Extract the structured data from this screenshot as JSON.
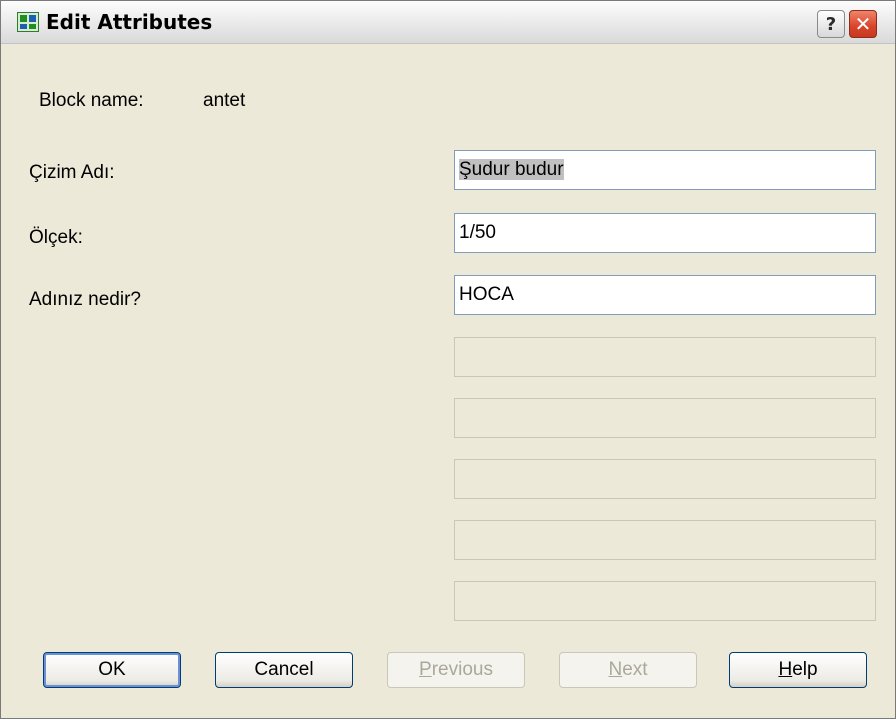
{
  "window": {
    "title": "Edit Attributes"
  },
  "block": {
    "label": "Block name:",
    "value": "antet"
  },
  "attributes": [
    {
      "label": "Çizim Adı:",
      "value": "Şudur budur"
    },
    {
      "label": "Ölçek:",
      "value": "1/50"
    },
    {
      "label": "Adınız nedir?",
      "value": "HOCA"
    }
  ],
  "buttons": {
    "ok": "OK",
    "cancel": "Cancel",
    "previous_first": "P",
    "previous_rest": "revious",
    "next_first": "N",
    "next_rest": "ext",
    "help_first": "H",
    "help_rest": "elp"
  },
  "titlebar": {
    "help_glyph": "?",
    "close_glyph": "✕"
  },
  "colors": {
    "background": "#ece9d8",
    "field_border": "#7f9db9",
    "selection": "#c0c0c0"
  }
}
